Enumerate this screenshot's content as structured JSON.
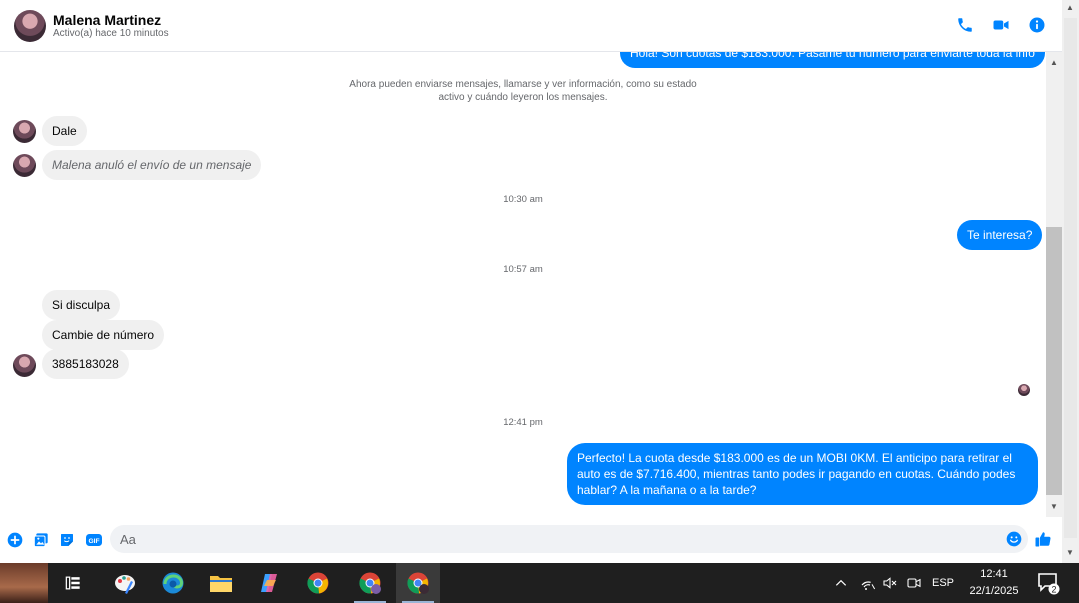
{
  "header": {
    "name": "Malena Martinez",
    "status": "Activo(a) hace 10 minutos"
  },
  "chat": {
    "top_partial_message": "Hola! Son cuotas de $183.000. Pasame tu número para enviarte toda la info",
    "system_notice": "Ahora pueden enviarse mensajes, llamarse y ver información, como su estado activo y cuándo leyeron los mensajes.",
    "messages": [
      {
        "text": "Dale"
      },
      {
        "text": "Malena anuló el envío de un mensaje"
      },
      {
        "time": "10:30 am"
      },
      {
        "text": "Te interesa?"
      },
      {
        "time": "10:57 am"
      },
      {
        "text": "Si disculpa"
      },
      {
        "text": "Cambie de número"
      },
      {
        "text": "3885183028"
      },
      {
        "time": "12:41 pm"
      },
      {
        "text": "Perfecto! La cuota desde $183.000 es de un MOBI 0KM. El anticipo para retirar el auto es de $7.716.400, mientras tanto podes ir pagando en cuotas. Cuándo podes hablar? A la mañana o a la tarde?"
      }
    ]
  },
  "composer": {
    "placeholder": "Aa"
  },
  "taskbar": {
    "language": "ESP",
    "time": "12:41",
    "date": "22/1/2025",
    "notification_count": "2"
  },
  "colors": {
    "accent": "#0084ff",
    "incoming_bubble": "#f0f0f0",
    "taskbar": "#1f1f1f"
  }
}
